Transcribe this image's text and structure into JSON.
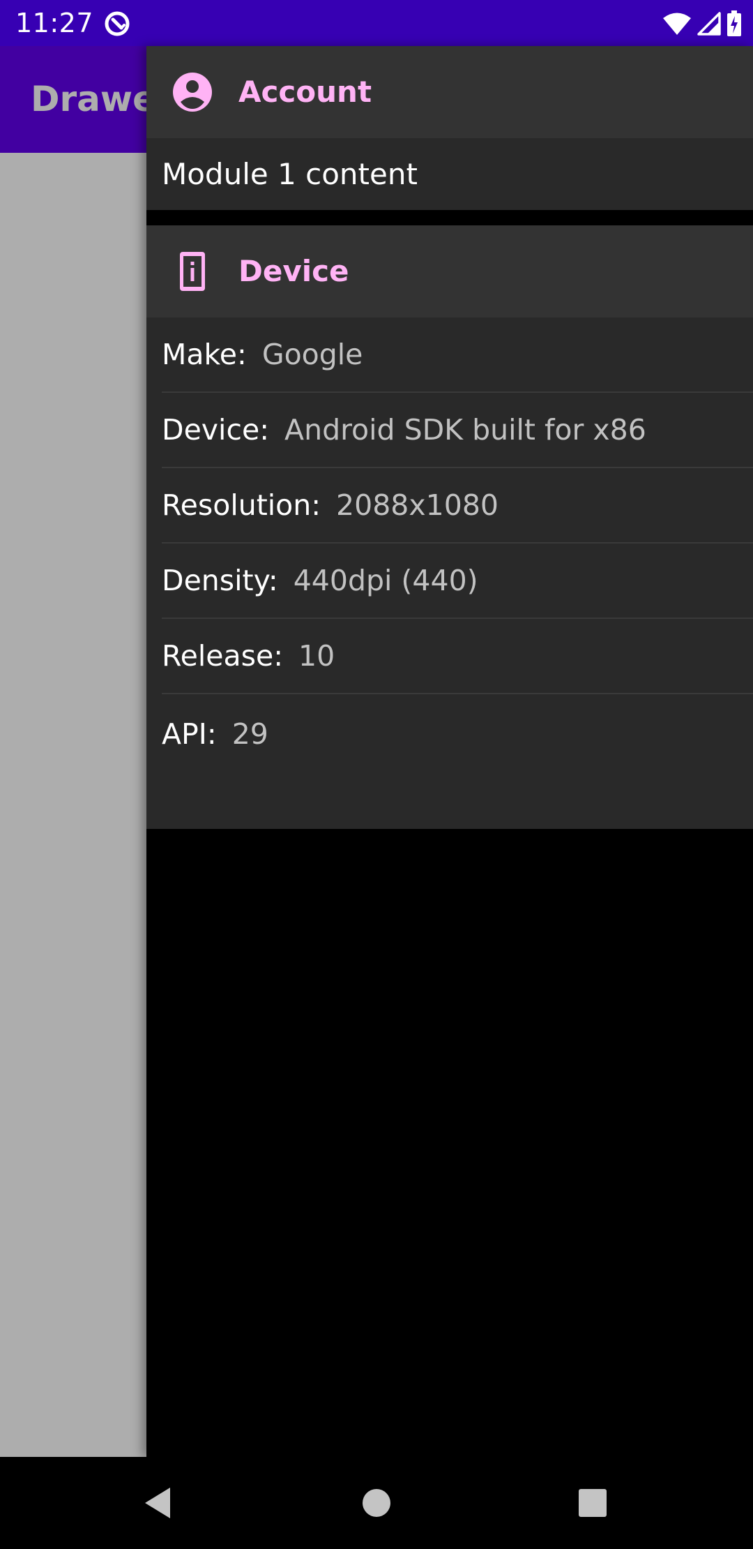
{
  "status_bar": {
    "time": "11:27",
    "icons": [
      "app-notification-icon",
      "wifi-icon",
      "cellular-signal-icon",
      "battery-charging-icon"
    ]
  },
  "app": {
    "title": "Drawer",
    "toolbar_color": "#6200ee"
  },
  "drawer": {
    "account_section": {
      "icon": "account-circle-icon",
      "title": "Account",
      "content": "Module 1 content"
    },
    "device_section": {
      "icon": "device-info-icon",
      "title": "Device",
      "rows": [
        {
          "key": "Make:",
          "value": "Google"
        },
        {
          "key": "Device:",
          "value": "Android SDK built for x86"
        },
        {
          "key": "Resolution:",
          "value": "2088x1080"
        },
        {
          "key": "Density:",
          "value": "440dpi (440)"
        },
        {
          "key": "Release:",
          "value": "10"
        },
        {
          "key": "API:",
          "value": "29"
        }
      ]
    },
    "accent_color": "#ffb3f5"
  },
  "nav_bar": {
    "buttons": [
      "back-icon",
      "home-icon",
      "recents-icon"
    ]
  }
}
